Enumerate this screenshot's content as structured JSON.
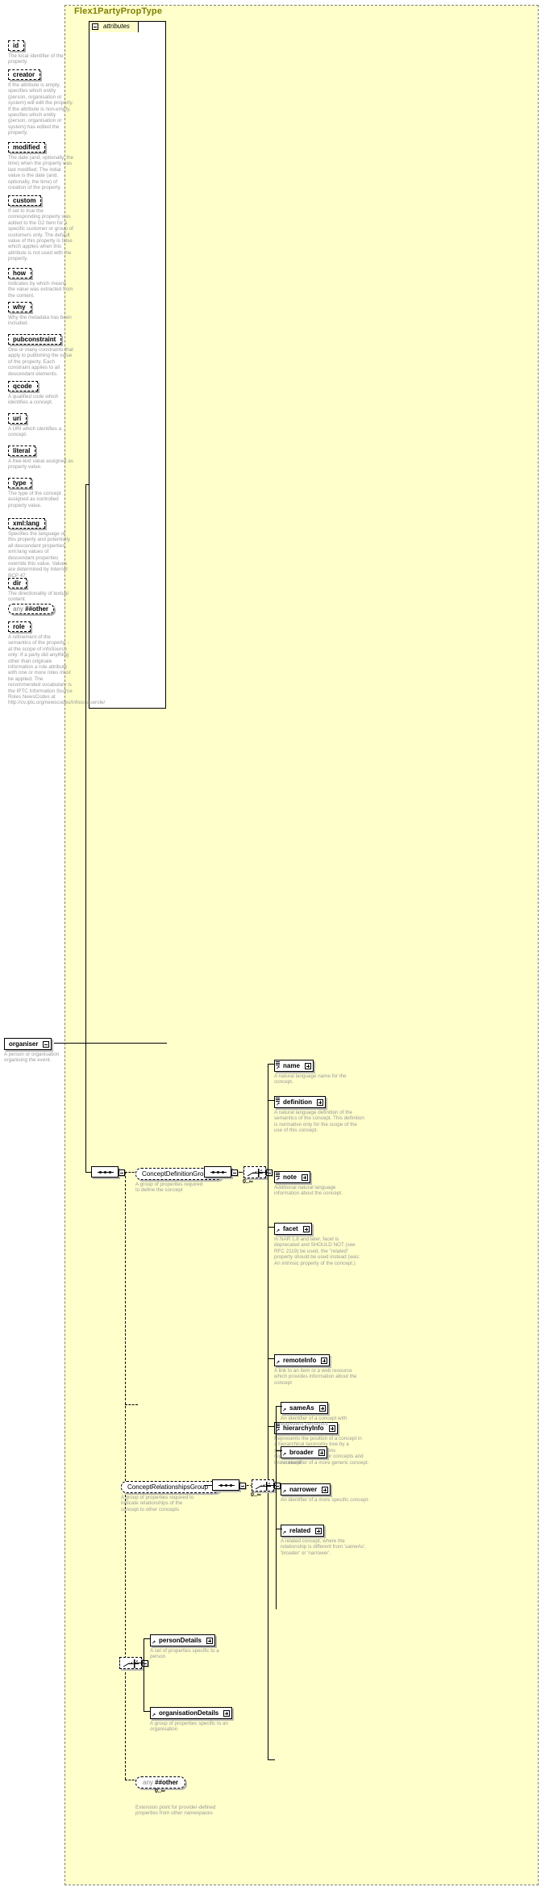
{
  "type_name": "Flex1PartyPropType",
  "attributes_panel": {
    "tab_label": "attributes",
    "items": [
      {
        "name": "id",
        "kind": "attribute",
        "desc": "The local identifier of the property."
      },
      {
        "name": "creator",
        "kind": "attribute",
        "desc": "If the attribute is empty, specifies which entity (person, organisation or system) will edit the property. If the attribute is non-empty, specifies which entity (person, organisation or system) has edited the property."
      },
      {
        "name": "modified",
        "kind": "attribute",
        "desc": "The date (and, optionally, the time) when the property was last modified. The initial value is the date (and, optionally, the time) of creation of the property."
      },
      {
        "name": "custom",
        "kind": "attribute",
        "desc": "If set to true the corresponding property was added to the G2 Item for a specific customer or group of customers only. The default value of this property is false which applies when this attribute is not used with the property."
      },
      {
        "name": "how",
        "kind": "attribute",
        "desc": "Indicates by which means the value was extracted from the content."
      },
      {
        "name": "why",
        "kind": "attribute",
        "desc": "Why the metadata has been included."
      },
      {
        "name": "pubconstraint",
        "kind": "attribute",
        "desc": "One or many constraints that apply to publishing the value of the property. Each constraint applies to all descendant elements."
      },
      {
        "name": "qcode",
        "kind": "attribute",
        "desc": "A qualified code which identifies a concept."
      },
      {
        "name": "uri",
        "kind": "attribute",
        "desc": "A URI which identifies a concept."
      },
      {
        "name": "literal",
        "kind": "attribute",
        "desc": "A free-text value assigned as property value."
      },
      {
        "name": "type",
        "kind": "attribute",
        "desc": "The type of the concept assigned as controlled property value."
      },
      {
        "name": "xml:lang",
        "kind": "attribute",
        "desc": "Specifies the language of this property and potentially all descendant properties. xml:lang values of descendant properties override this value. Values are determined by Internet BCP 47."
      },
      {
        "name": "dir",
        "kind": "attribute",
        "desc": "The directionality of textual content."
      },
      {
        "name": "##other",
        "kind": "any",
        "any_prefix": "any",
        "desc": ""
      },
      {
        "name": "role",
        "kind": "attribute",
        "desc": "A refinement of the semantics of the property. - at the scope of infoSource only: If a party did anything other than originate information a role attribute with one or more roles must be applied. The recommended vocabulary is the IPTC Information Source Roles NewsCodes at http://cv.iptc.org/newscodes/infosourcerole/"
      }
    ]
  },
  "root_element": {
    "name": "organiser",
    "desc": "A person or organisation organising the event."
  },
  "groups": [
    {
      "id": "concept-definition-group",
      "name": "ConceptDefinitionGroup",
      "desc": "A group of properites required to define the concept",
      "cardinality": "0..∞",
      "children": [
        {
          "name": "name",
          "desc": "A natural language name for the concept."
        },
        {
          "name": "definition",
          "desc": "A natural language definition of the semantics of the concept. This definition is normative only for the scope of the use of this concept."
        },
        {
          "name": "note",
          "desc": "Additional natural language information about the concept."
        },
        {
          "name": "facet",
          "desc": "In NAR 1.8 and later, facet is deprecated and SHOULD NOT (see RFC 2119) be used, the \"related\" property should be used instead (was: An intrinsic property of the concept.)"
        },
        {
          "name": "remoteInfo",
          "desc": "A link to an item or a web resource which provides information about the concept"
        },
        {
          "name": "hierarchyInfo",
          "desc": "Represents the position of a concept in a hierarchical taxonomy tree by a sequence of QCode tokens representing the ancestor concepts and this concept"
        }
      ]
    },
    {
      "id": "concept-relationships-group",
      "name": "ConceptRelationshipsGroup",
      "desc": "A group of properties required to indicate relationships of the concept to other concepts",
      "cardinality": "0..∞",
      "children": [
        {
          "name": "sameAs",
          "desc": "An identifier of a concept with equivalent semantics"
        },
        {
          "name": "broader",
          "desc": "An identifier of a more generic concept."
        },
        {
          "name": "narrower",
          "desc": "An identifier of a more specific concept."
        },
        {
          "name": "related",
          "desc": "A related concept, where the relationship is different from 'sameAs', 'broader' or 'narrower'."
        }
      ]
    }
  ],
  "details_choice": {
    "children": [
      {
        "name": "personDetails",
        "desc": "A set of properties specific to a person"
      },
      {
        "name": "organisationDetails",
        "desc": "A group of properties specific to an organisation"
      }
    ]
  },
  "any_extension": {
    "any_prefix": "any",
    "name": "##other",
    "cardinality": "0..∞",
    "desc": "Extension point for provider-defined properties from other namespaces"
  },
  "colors": {
    "type_bg": "#ffffcc",
    "panel_bg": "#ffffff",
    "title": "#808000",
    "desc_text": "#999999",
    "line": "#000000",
    "shadow": "#b8b8b8"
  }
}
